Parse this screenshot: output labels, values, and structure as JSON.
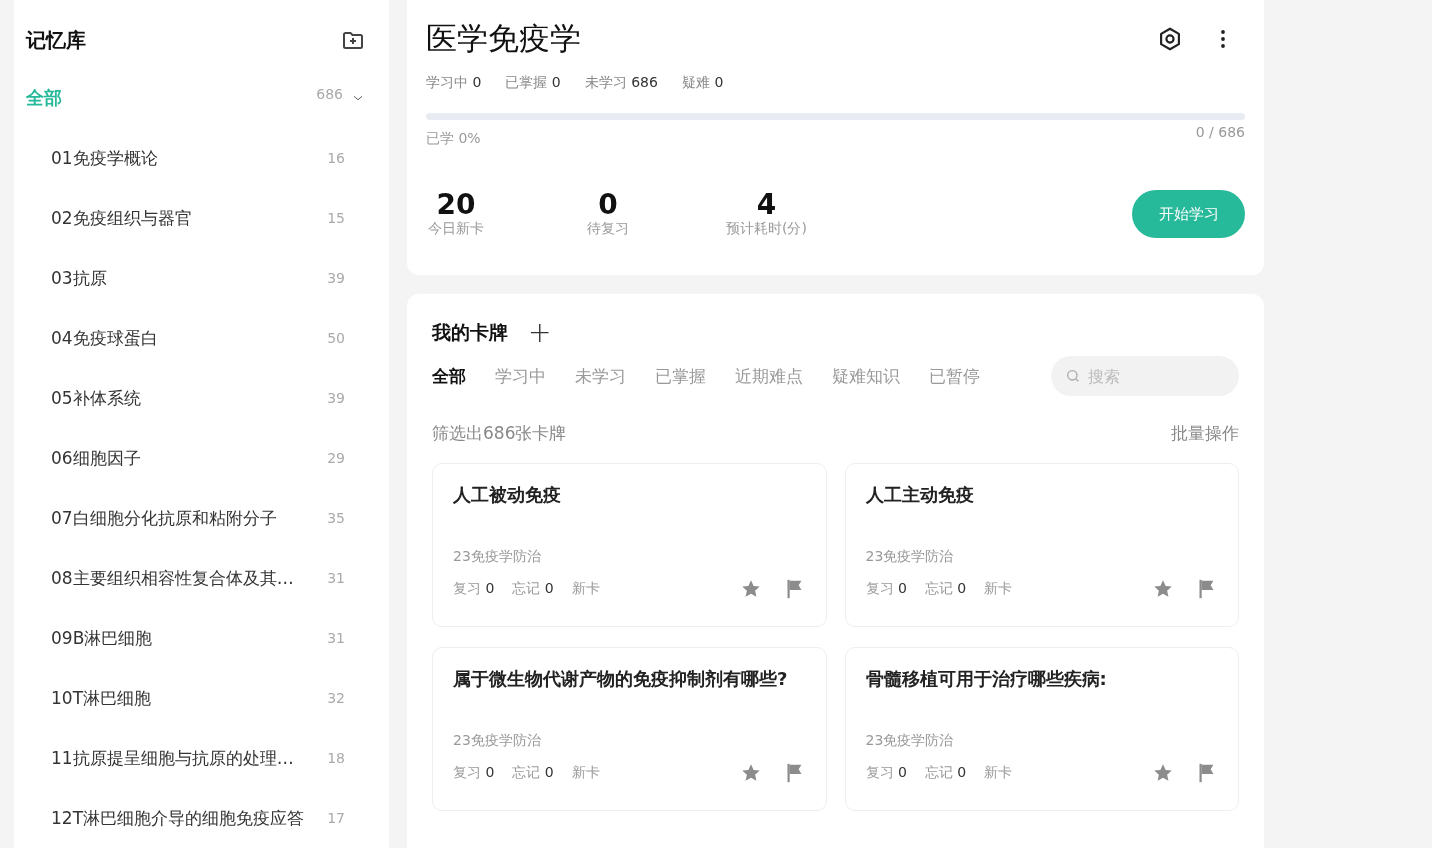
{
  "sidebar": {
    "title": "记忆库",
    "all": {
      "label": "全部",
      "count": "686",
      "selected": true,
      "expanded": true
    },
    "items": [
      {
        "name": "01免疫学概论",
        "count": "16",
        "selected": false
      },
      {
        "name": "02免疫组织与器官",
        "count": "15",
        "selected": false
      },
      {
        "name": "03抗原",
        "count": "39",
        "selected": false
      },
      {
        "name": "04免疫球蛋白",
        "count": "50",
        "selected": false
      },
      {
        "name": "05补体系统",
        "count": "39",
        "selected": false
      },
      {
        "name": "06细胞因子",
        "count": "29",
        "selected": false
      },
      {
        "name": "07白细胞分化抗原和粘附分子",
        "count": "35",
        "selected": false
      },
      {
        "name": "08主要组织相容性复合体及其…",
        "count": "31",
        "selected": false
      },
      {
        "name": "09B淋巴细胞",
        "count": "31",
        "selected": false
      },
      {
        "name": "10T淋巴细胞",
        "count": "32",
        "selected": false
      },
      {
        "name": "11抗原提呈细胞与抗原的处理…",
        "count": "18",
        "selected": false
      },
      {
        "name": "12T淋巴细胞介导的细胞免疫应答",
        "count": "17",
        "selected": false
      }
    ]
  },
  "deck": {
    "title": "医学免疫学",
    "stats": [
      {
        "label": "学习中",
        "value": "0"
      },
      {
        "label": "已掌握",
        "value": "0"
      },
      {
        "label": "未学习",
        "value": "686"
      },
      {
        "label": "疑难",
        "value": "0"
      }
    ],
    "progress": {
      "level": 0,
      "label": "已学 0%",
      "reading": "0 / 686"
    },
    "summary": [
      {
        "value": "20",
        "label": "今日新卡"
      },
      {
        "value": "0",
        "label": "待复习"
      },
      {
        "value": "4",
        "label": "预计耗时(分)"
      }
    ],
    "start_button": "开始学习"
  },
  "cards_panel": {
    "title": "我的卡牌",
    "add": "+",
    "tabs": [
      {
        "label": "全部",
        "selected": true
      },
      {
        "label": "学习中",
        "selected": false
      },
      {
        "label": "未学习",
        "selected": false
      },
      {
        "label": "已掌握",
        "selected": false
      },
      {
        "label": "近期难点",
        "selected": false
      },
      {
        "label": "疑难知识",
        "selected": false
      },
      {
        "label": "已暂停",
        "selected": false
      }
    ],
    "search": {
      "placeholder": "搜索"
    },
    "filter_text": "筛选出686张卡牌",
    "bulk_action": "批量操作",
    "cards": [
      {
        "title": "人工被动免疫",
        "deck": "23免疫学防治",
        "review_label": "复习",
        "review": "0",
        "forget_label": "忘记",
        "forget": "0",
        "status": "新卡",
        "starred": false,
        "flagged": false
      },
      {
        "title": "人工主动免疫",
        "deck": "23免疫学防治",
        "review_label": "复习",
        "review": "0",
        "forget_label": "忘记",
        "forget": "0",
        "status": "新卡",
        "starred": false,
        "flagged": false
      },
      {
        "title": "属于微生物代谢产物的免疫抑制剂有哪些?",
        "deck": "23免疫学防治",
        "review_label": "复习",
        "review": "0",
        "forget_label": "忘记",
        "forget": "0",
        "status": "新卡",
        "starred": false,
        "flagged": false
      },
      {
        "title": "骨髓移植可用于治疗哪些疾病:",
        "deck": "23免疫学防治",
        "review_label": "复习",
        "review": "0",
        "forget_label": "忘记",
        "forget": "0",
        "status": "新卡",
        "starred": false,
        "flagged": false
      }
    ]
  }
}
